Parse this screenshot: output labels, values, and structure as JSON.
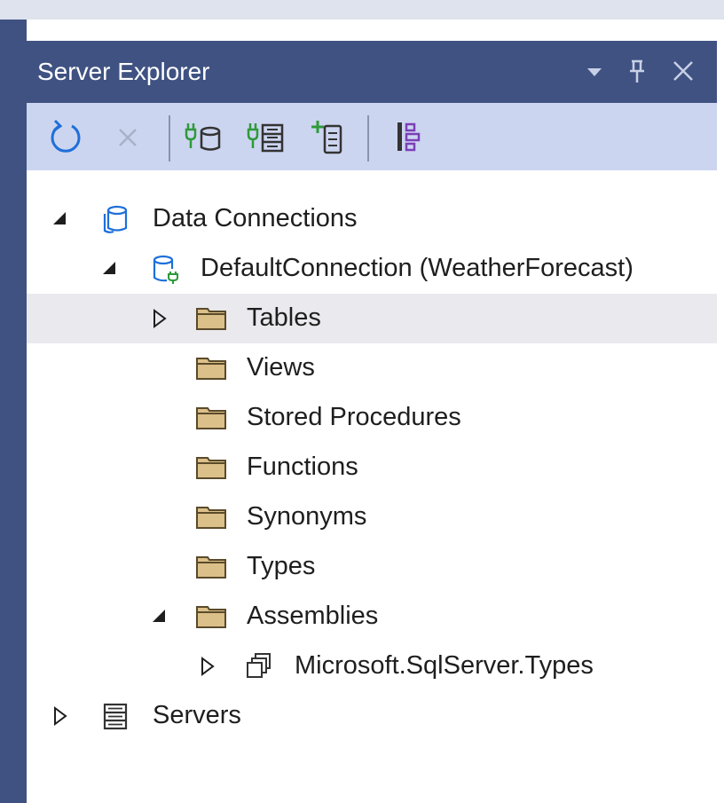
{
  "window": {
    "title": "Server Explorer",
    "title_icons": [
      "dropdown-icon",
      "pin-icon",
      "close-icon"
    ]
  },
  "toolbar": {
    "items": [
      {
        "name": "refresh",
        "icon": "refresh-icon",
        "enabled": true
      },
      {
        "name": "stop",
        "icon": "stop-icon",
        "enabled": false
      },
      {
        "name": "connect-to-database",
        "icon": "connect-database-icon",
        "enabled": true
      },
      {
        "name": "connect-to-server",
        "icon": "connect-server-icon",
        "enabled": true
      },
      {
        "name": "add-sharepoint-connection",
        "icon": "add-connection-icon",
        "enabled": true
      },
      {
        "name": "properties",
        "icon": "properties-icon",
        "enabled": true
      }
    ]
  },
  "tree": {
    "nodes": [
      {
        "label": "Data Connections",
        "icon": "data-connections-icon",
        "expander": "expanded"
      },
      {
        "label": "DefaultConnection (WeatherForecast)",
        "icon": "database-connection-icon",
        "expander": "expanded"
      },
      {
        "label": "Tables",
        "icon": "folder-icon",
        "expander": "collapsed",
        "selected": true
      },
      {
        "label": "Views",
        "icon": "folder-icon",
        "expander": "none"
      },
      {
        "label": "Stored Procedures",
        "icon": "folder-icon",
        "expander": "none"
      },
      {
        "label": "Functions",
        "icon": "folder-icon",
        "expander": "none"
      },
      {
        "label": "Synonyms",
        "icon": "folder-icon",
        "expander": "none"
      },
      {
        "label": "Types",
        "icon": "folder-icon",
        "expander": "none"
      },
      {
        "label": "Assemblies",
        "icon": "folder-icon",
        "expander": "expanded"
      },
      {
        "label": "Microsoft.SqlServer.Types",
        "icon": "assembly-icon",
        "expander": "collapsed"
      },
      {
        "label": "Servers",
        "icon": "servers-icon",
        "expander": "collapsed"
      }
    ]
  },
  "colors": {
    "title_bar": "#3f5282",
    "toolbar": "#ccd5f0",
    "selected_row": "#e9e9ee",
    "folder_fill": "#dcc08a",
    "accent_blue": "#1e6fd9",
    "accent_green": "#2e9a3a",
    "accent_purple": "#7b3fb6"
  }
}
